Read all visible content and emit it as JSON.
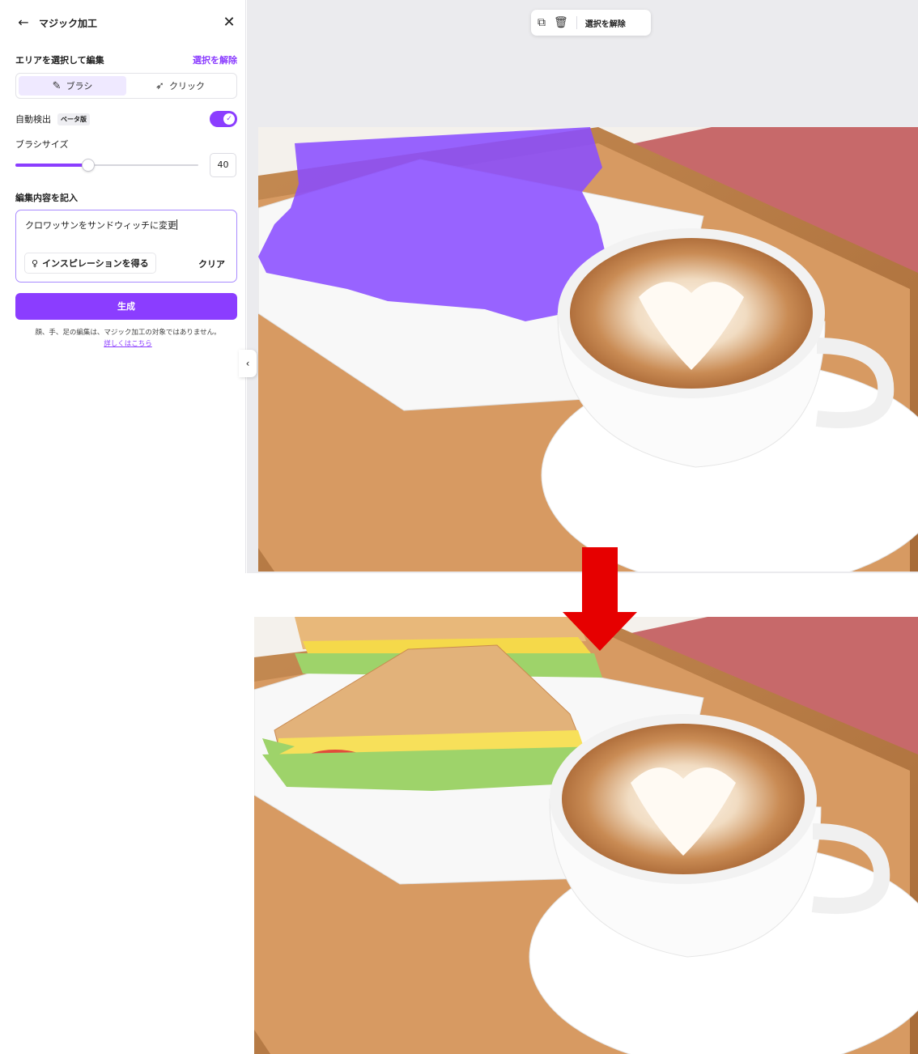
{
  "panel": {
    "title": "マジック加工",
    "select_area_label": "エリアを選択して編集",
    "deselect_link": "選択を解除",
    "modes": [
      {
        "label": "ブラシ",
        "icon": "magic-brush-icon",
        "active": true
      },
      {
        "label": "クリック",
        "icon": "magic-click-icon",
        "active": false
      }
    ],
    "auto_detect_label": "自動検出",
    "beta_badge": "ベータ版",
    "auto_detect_on": true,
    "brush_size_label": "ブラシサイズ",
    "brush_size_value": "40",
    "brush_size_fraction": 0.4,
    "prompt_label": "編集内容を記入",
    "prompt_value": "クロワッサンをサンドウィッチに変更",
    "inspire_label": "インスピレーションを得る",
    "clear_label": "クリア",
    "generate_label": "生成",
    "notice_text": "顔、手、足の編集は、マジック加工の対象ではありません。",
    "notice_link": "詳しくはこちら"
  },
  "toolbar": {
    "deselect_label": "選択を解除"
  },
  "colors": {
    "accent": "#8b3dff",
    "mask": "#8a4dff",
    "arrow": "#e60000"
  }
}
